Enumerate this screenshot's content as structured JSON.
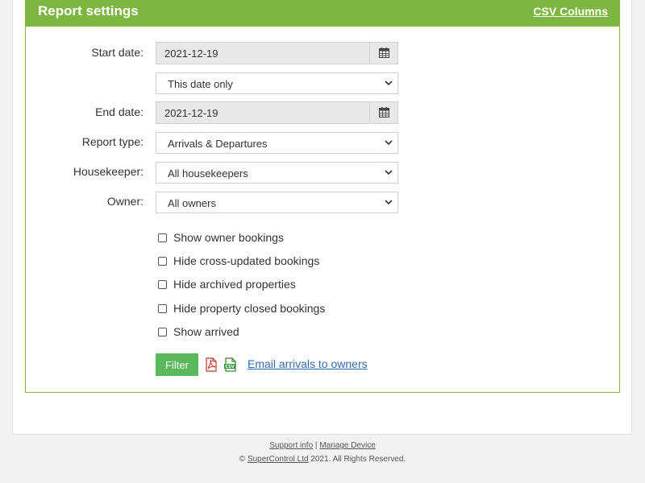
{
  "header": {
    "title": "Report settings",
    "csv_columns_label": "CSV Columns"
  },
  "form": {
    "start_date_label": "Start date:",
    "start_date_value": "2021-12-19",
    "date_range_value": "This date only",
    "end_date_label": "End date:",
    "end_date_value": "2021-12-19",
    "report_type_label": "Report type:",
    "report_type_value": "Arrivals & Departures",
    "housekeeper_label": "Housekeeper:",
    "housekeeper_value": "All housekeepers",
    "owner_label": "Owner:",
    "owner_value": "All owners"
  },
  "options": [
    {
      "label": "Show owner bookings",
      "checked": false
    },
    {
      "label": "Hide cross-updated bookings",
      "checked": false
    },
    {
      "label": "Hide archived properties",
      "checked": false
    },
    {
      "label": "Hide property closed bookings",
      "checked": false
    },
    {
      "label": "Show arrived",
      "checked": false
    }
  ],
  "actions": {
    "filter_label": "Filter",
    "pdf_icon": "pdf-icon",
    "csv_icon": "csv-icon",
    "csv_icon_text": "CSV",
    "email_label": "Email arrivals to owners"
  },
  "footer": {
    "support_label": "Support info",
    "separator": "|",
    "manage_label": "Manage Device",
    "copyright_prefix": "©",
    "company_label": "SuperControl Ltd",
    "copyright_suffix": "2021. All Rights Reserved."
  },
  "colors": {
    "brand_green": "#7db642",
    "button_green": "#5cb85c",
    "link_blue": "#3368b0"
  }
}
